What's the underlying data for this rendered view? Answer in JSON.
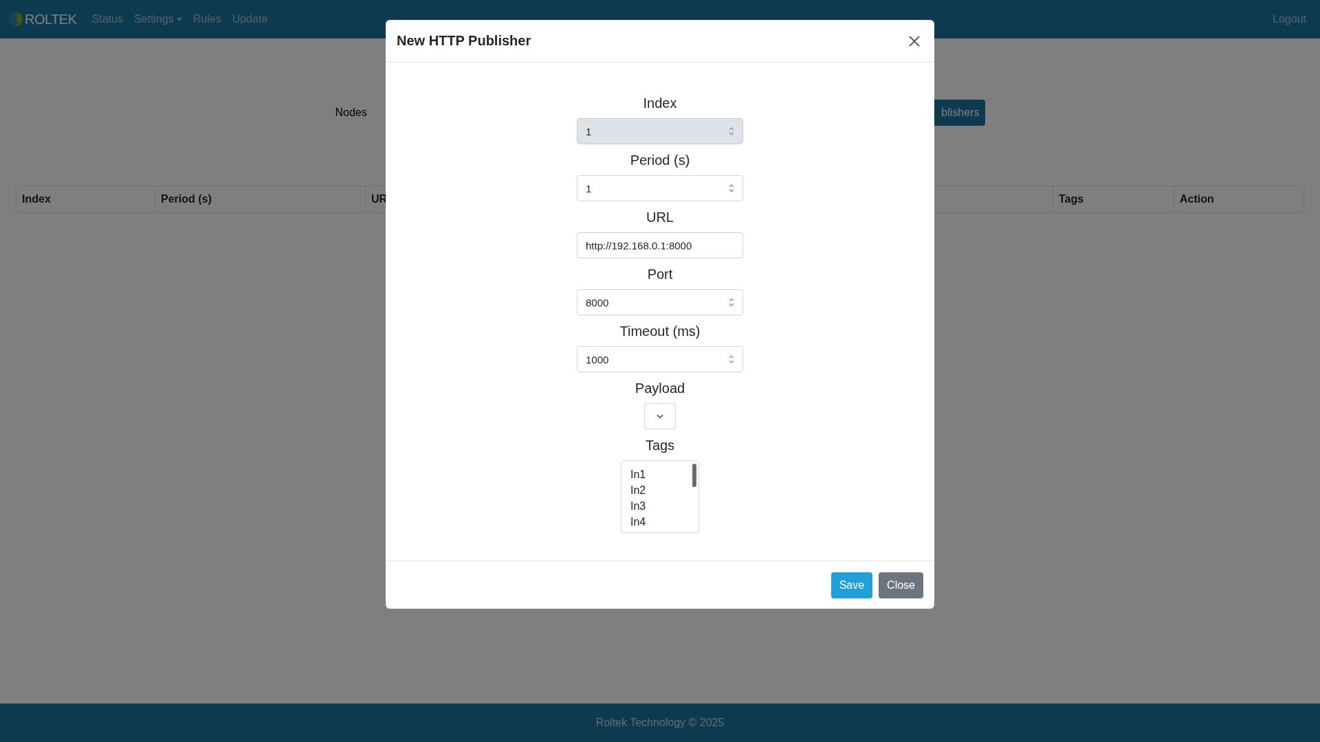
{
  "navbar": {
    "brand": "ROLTEK",
    "items": [
      {
        "label": "Status",
        "dropdown": false
      },
      {
        "label": "Settings",
        "dropdown": true
      },
      {
        "label": "Rules",
        "dropdown": false
      },
      {
        "label": "Update",
        "dropdown": false
      }
    ],
    "logout": "Logout"
  },
  "page": {
    "nodes_label": "Nodes",
    "publishers_button": "blishers",
    "table": {
      "columns": [
        "Index",
        "Period (s)",
        "UR",
        "Tags",
        "Action"
      ]
    }
  },
  "modal": {
    "title": "New HTTP Publisher",
    "fields": [
      {
        "label": "Index",
        "kind": "number",
        "value": "1",
        "disabled": true
      },
      {
        "label": "Period (s)",
        "kind": "number",
        "value": "1",
        "disabled": false
      },
      {
        "label": "URL",
        "kind": "text",
        "value": "http://192.168.0.1:8000",
        "disabled": false
      },
      {
        "label": "Port",
        "kind": "number",
        "value": "8000",
        "disabled": false
      },
      {
        "label": "Timeout (ms)",
        "kind": "number",
        "value": "1000",
        "disabled": false
      },
      {
        "label": "Payload",
        "kind": "select"
      },
      {
        "label": "Tags",
        "kind": "listbox",
        "options": [
          "In1",
          "In2",
          "In3",
          "In4"
        ]
      }
    ],
    "buttons": [
      {
        "label": "Save",
        "kind": "primary"
      },
      {
        "label": "Close",
        "kind": "secondary"
      }
    ]
  },
  "footer": "Roltek Technology © 2025"
}
